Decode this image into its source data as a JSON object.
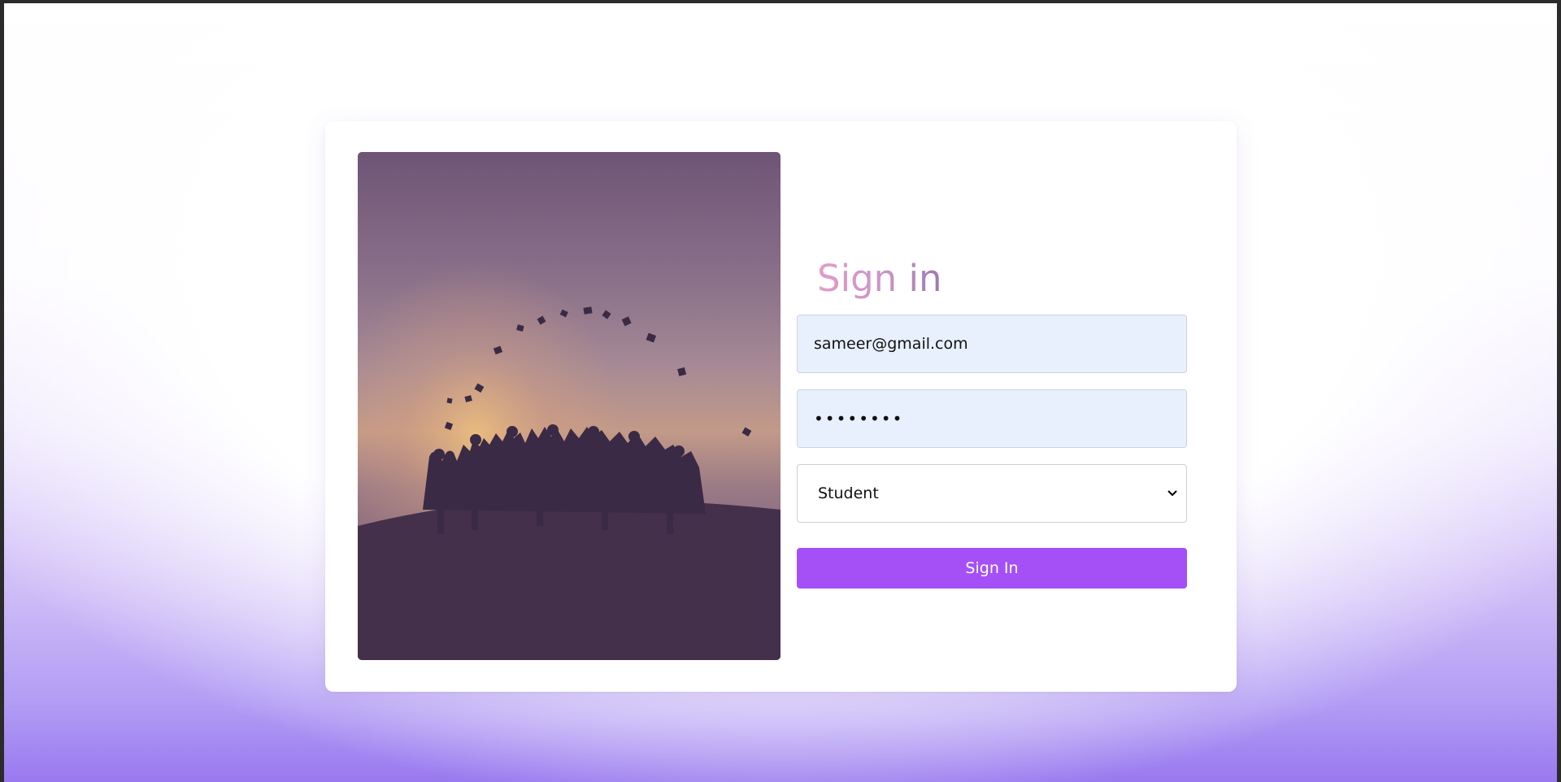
{
  "login": {
    "title": "Sign in",
    "email_value": "sameer@gmail.com",
    "password_value": "••••••••",
    "role_selected": "Student",
    "submit_label": "Sign In"
  },
  "image": {
    "icon": "graduation-photo",
    "subject": "graduates tossing caps at sunset"
  },
  "colors": {
    "accent": "#a550f7",
    "input_bg": "#e8f0fe",
    "title_gradient_start": "#e39cc7",
    "title_gradient_end": "#9c7ab0",
    "background_bottom": "#9a79ef"
  }
}
